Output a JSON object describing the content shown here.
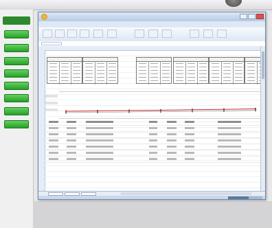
{
  "window_title": "",
  "user_tag": "",
  "launcher": {
    "header": "",
    "buttons": [
      {
        "label": ""
      },
      {
        "label": ""
      },
      {
        "label": ""
      },
      {
        "label": ""
      },
      {
        "label": ""
      },
      {
        "label": ""
      },
      {
        "label": ""
      },
      {
        "label": ""
      }
    ]
  },
  "excel": {
    "caption": "",
    "ribbon_tabs": [
      "",
      "",
      "",
      "",
      "",
      "",
      "",
      ""
    ],
    "name_box": "",
    "sheet_heading": [
      "",
      "",
      "",
      ""
    ],
    "schedule_blocks": 6,
    "trend_chart": {
      "lines": [
        {
          "color": "#cc2a2a",
          "values": [
            0.0,
            0.05,
            0.1,
            0.15,
            0.22,
            0.28,
            0.35
          ]
        },
        {
          "color": "#7a7a7a",
          "values": [
            0.0,
            0.05,
            0.1,
            0.15,
            0.2,
            0.26,
            0.33
          ]
        }
      ]
    },
    "table": {
      "columns": 10,
      "rows": 6
    },
    "sheet_tabs": [
      "",
      "",
      ""
    ],
    "status": "",
    "zoom_fraction": 0.6
  },
  "colors": {
    "launcher_green": "#27a027",
    "excel_blue": "#b6cbe6",
    "trend_red": "#cc2a2a"
  }
}
